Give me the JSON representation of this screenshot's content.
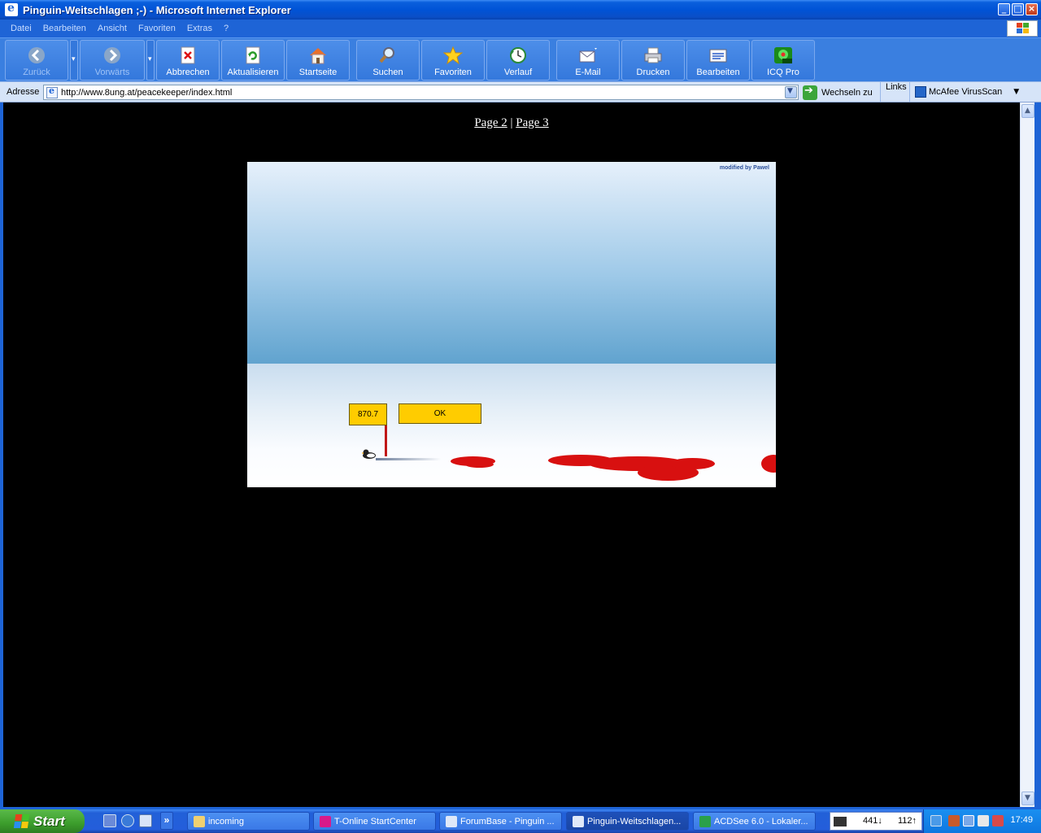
{
  "window": {
    "title": "Pinguin-Weitschlagen ;-) - Microsoft Internet Explorer"
  },
  "menu": [
    "Datei",
    "Bearbeiten",
    "Ansicht",
    "Favoriten",
    "Extras",
    "?"
  ],
  "toolbar": {
    "back": "Zurück",
    "forward": "Vorwärts",
    "stop": "Abbrechen",
    "refresh": "Aktualisieren",
    "home": "Startseite",
    "search": "Suchen",
    "favorites": "Favoriten",
    "history": "Verlauf",
    "mail": "E-Mail",
    "print": "Drucken",
    "edit": "Bearbeiten",
    "icq": "ICQ Pro"
  },
  "address": {
    "label": "Adresse",
    "url": "http://www.8ung.at/peacekeeper/index.html",
    "go_label": "Wechseln zu",
    "links_label": "Links",
    "mcafee_label": "McAfee VirusScan"
  },
  "page": {
    "link_page2": "Page 2",
    "separator": "|",
    "link_page3": "Page 3"
  },
  "game": {
    "credit": "modified by Pawel",
    "distance": "870.7",
    "ok_label": "OK"
  },
  "taskbar": {
    "start_label": "Start",
    "tasks": [
      "incoming",
      "T-Online StartCenter",
      "ForumBase - Pinguin ...",
      "Pinguin-Weitschlagen...",
      "ACDSee 6.0 - Lokaler..."
    ],
    "net_down": "441",
    "net_up": "112",
    "clock": "17:49",
    "quicklaunch_more": "»"
  }
}
